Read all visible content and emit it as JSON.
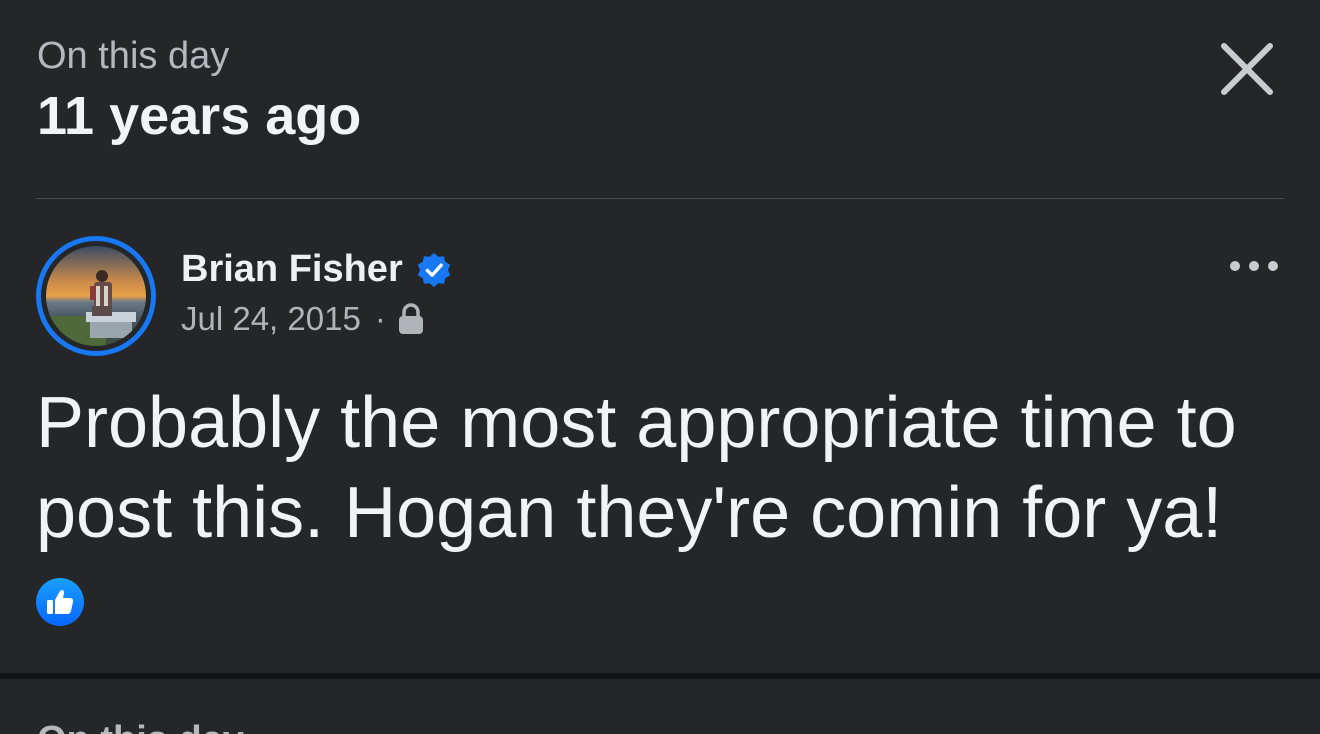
{
  "header": {
    "kicker": "On this day",
    "title": "11 years ago"
  },
  "icons": {
    "close": "close-icon",
    "more": "more-options-icon",
    "verified": "verified-badge-icon",
    "privacy": "lock-icon",
    "reaction": "thumbs-up-icon"
  },
  "post": {
    "author": "Brian Fisher",
    "date": "Jul 24, 2015",
    "separator": "·",
    "text": "Probably the most appropriate time to post this. Hogan they're comin for ya!"
  },
  "next_section": {
    "title": "On this day"
  },
  "colors": {
    "background": "#252628",
    "accent": "#1877f2",
    "primary_text": "#f2f3f5",
    "secondary_text": "#b0b3b8"
  }
}
